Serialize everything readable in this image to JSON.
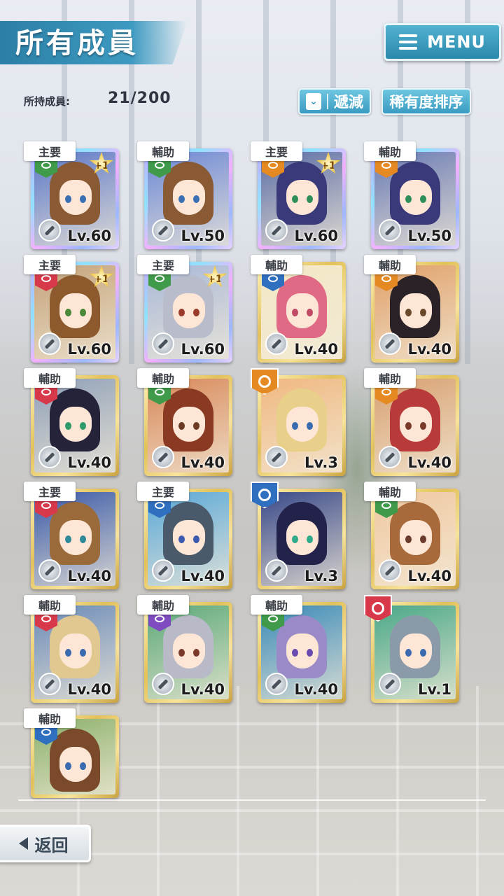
{
  "header": {
    "title": "所有成員",
    "menu_label": "MENU",
    "owned_label": "所持成員:",
    "owned_count": "21/200",
    "filter_label": "遞減",
    "sort_label": "稀有度排序"
  },
  "colors": {
    "attr_green": "#3f9a4a",
    "attr_orange": "#e58a22",
    "attr_red": "#d8394a",
    "attr_blue": "#2f6fc0",
    "attr_purple": "#7f4cc0",
    "accent_blue": "#3a9bc1"
  },
  "members": [
    {
      "role": "主要",
      "level": "Lv.60",
      "attr": "green",
      "frame": "rainbow",
      "plus": "+1",
      "hair": "#8a5a34",
      "bg": "#5c78c8",
      "eye": "#3b6fb3"
    },
    {
      "role": "輔助",
      "level": "Lv.50",
      "attr": "green",
      "frame": "rainbow",
      "plus": "",
      "hair": "#8a5a34",
      "bg": "#6c88d6",
      "eye": "#3b6fb3"
    },
    {
      "role": "主要",
      "level": "Lv.60",
      "attr": "orange",
      "frame": "rainbow",
      "plus": "+1",
      "hair": "#3a3a7a",
      "bg": "#5d6ea6",
      "eye": "#2f8f5a"
    },
    {
      "role": "輔助",
      "level": "Lv.50",
      "attr": "orange",
      "frame": "rainbow",
      "plus": "",
      "hair": "#3a3a7a",
      "bg": "#6a7bb4",
      "eye": "#2f8f5a"
    },
    {
      "role": "主要",
      "level": "Lv.60",
      "attr": "red",
      "frame": "rainbow",
      "plus": "+1",
      "hair": "#8c5a2c",
      "bg": "#c4a27a",
      "eye": "#4a8a3a"
    },
    {
      "role": "主要",
      "level": "Lv.60",
      "attr": "green",
      "frame": "rainbow",
      "plus": "+1",
      "hair": "#b8bccb",
      "bg": "#a8b8d8",
      "eye": "#9a3a2a"
    },
    {
      "role": "輔助",
      "level": "Lv.40",
      "attr": "blue",
      "frame": "gold",
      "plus": "",
      "hair": "#e06a86",
      "bg": "#f3e7c4",
      "eye": "#c04a66"
    },
    {
      "role": "輔助",
      "level": "Lv.40",
      "attr": "orange",
      "frame": "gold",
      "plus": "",
      "hair": "#2a2226",
      "bg": "#e0a068",
      "eye": "#6a4a2a"
    },
    {
      "role": "輔助",
      "level": "Lv.40",
      "attr": "red",
      "frame": "gold",
      "plus": "",
      "hair": "#24233a",
      "bg": "#8fa0b8",
      "eye": "#2f9a6a"
    },
    {
      "role": "輔助",
      "level": "Lv.40",
      "attr": "green",
      "frame": "gold",
      "plus": "",
      "hair": "#8a3a22",
      "bg": "#d88858",
      "eye": "#6a3a22"
    },
    {
      "role": "",
      "level": "Lv.3",
      "attr": "orange",
      "frame": "gold",
      "plus": "",
      "hair": "#e8d08a",
      "bg": "#f0b880",
      "eye": "#3a6ab0"
    },
    {
      "role": "輔助",
      "level": "Lv.40",
      "attr": "orange",
      "frame": "gold",
      "plus": "",
      "hair": "#b83a3a",
      "bg": "#d8a070",
      "eye": "#7a3a2a"
    },
    {
      "role": "主要",
      "level": "Lv.40",
      "attr": "red",
      "frame": "gold",
      "plus": "",
      "hair": "#9a6a3a",
      "bg": "#3a5aa8",
      "eye": "#2f8a9a"
    },
    {
      "role": "主要",
      "level": "Lv.40",
      "attr": "blue",
      "frame": "gold",
      "plus": "",
      "hair": "#4a5a6a",
      "bg": "#5aa8d8",
      "eye": "#3a5ab0"
    },
    {
      "role": "",
      "level": "Lv.3",
      "attr": "blue",
      "frame": "gold",
      "plus": "",
      "hair": "#22224a",
      "bg": "#3a4a8a",
      "eye": "#2faa8a"
    },
    {
      "role": "輔助",
      "level": "Lv.40",
      "attr": "green",
      "frame": "gold",
      "plus": "",
      "hair": "#a86a3a",
      "bg": "#f0c8a0",
      "eye": "#6a3a2a"
    },
    {
      "role": "輔助",
      "level": "Lv.40",
      "attr": "red",
      "frame": "gold",
      "plus": "",
      "hair": "#e0c890",
      "bg": "#6a8ab8",
      "eye": "#3a6ab0"
    },
    {
      "role": "輔助",
      "level": "Lv.40",
      "attr": "purple",
      "frame": "gold",
      "plus": "",
      "hair": "#b8bac8",
      "bg": "#5aa878",
      "eye": "#7a3a2a"
    },
    {
      "role": "輔助",
      "level": "Lv.40",
      "attr": "green",
      "frame": "gold",
      "plus": "",
      "hair": "#9a8ac8",
      "bg": "#3a8ab8",
      "eye": "#6a4ab0"
    },
    {
      "role": "",
      "level": "Lv.1",
      "attr": "red",
      "frame": "gold",
      "plus": "",
      "hair": "#8a9aa8",
      "bg": "#4aa888",
      "eye": "#3a6ab0"
    },
    {
      "role": "輔助",
      "level": "",
      "attr": "blue",
      "frame": "gold",
      "plus": "",
      "hair": "#7a4a2a",
      "bg": "#8ab06a",
      "eye": "#3a6ab0"
    }
  ],
  "footer": {
    "back_label": "返回"
  }
}
